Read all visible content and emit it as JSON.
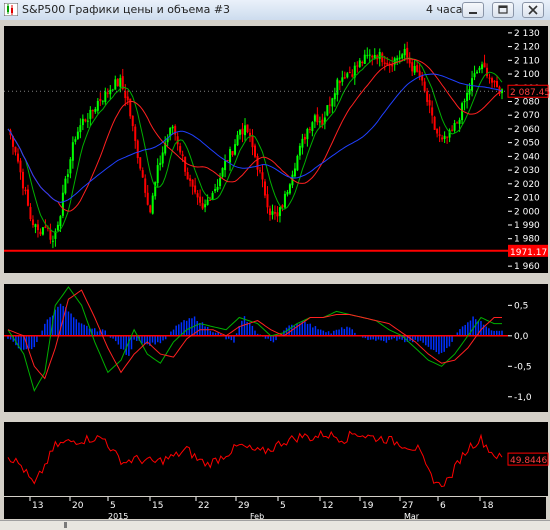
{
  "window": {
    "title": "S&P500 Графики цены и объема #3",
    "timeframe": "4 часа",
    "icon": "candlestick-chart-icon",
    "buttons": [
      "minimize-icon",
      "maximize-icon",
      "close-icon"
    ]
  },
  "colors": {
    "background": "#000000",
    "grid": "#5a5a5a",
    "bull_candle": "#00ff00",
    "bear_candle": "#ff0000",
    "ma_fast": "#00b000",
    "ma_mid": "#ff2020",
    "ma_slow": "#2040ff",
    "support_line": "#ff0000",
    "histogram": "#0030ff",
    "zero_line": "#ff0000",
    "oscillator": "#ff0000",
    "text": "#ffffff"
  },
  "chart_data": [
    {
      "type": "candlestick",
      "panel": "price",
      "ylim": [
        1955,
        2135
      ],
      "y_ticks": [
        "2 130",
        "2 120",
        "2 110",
        "2 100",
        "2 090",
        "2 080",
        "2 070",
        "2 060",
        "2 050",
        "2 040",
        "2 030",
        "2 020",
        "2 010",
        "2 000",
        "1 990",
        "1 980",
        "1 970",
        "1 960"
      ],
      "current_price_label": "2 087.45",
      "current_price": 2087.45,
      "support_label": "1971.17",
      "support_level": 1971.17,
      "series": [
        "MA fast (green)",
        "MA mid (red)",
        "MA slow (blue)"
      ],
      "close_path": [
        [
          0,
          2060
        ],
        [
          3,
          2045
        ],
        [
          6,
          2020
        ],
        [
          9,
          1995
        ],
        [
          12,
          1985
        ],
        [
          15,
          1990
        ],
        [
          18,
          1978
        ],
        [
          21,
          2000
        ],
        [
          24,
          2030
        ],
        [
          27,
          2055
        ],
        [
          30,
          2066
        ],
        [
          33,
          2070
        ],
        [
          36,
          2080
        ],
        [
          39,
          2085
        ],
        [
          42,
          2092
        ],
        [
          45,
          2094
        ],
        [
          48,
          2080
        ],
        [
          51,
          2050
        ],
        [
          54,
          2025
        ],
        [
          57,
          2000
        ],
        [
          60,
          2030
        ],
        [
          63,
          2050
        ],
        [
          66,
          2062
        ],
        [
          69,
          2045
        ],
        [
          72,
          2025
        ],
        [
          75,
          2010
        ],
        [
          78,
          2000
        ],
        [
          81,
          2012
        ],
        [
          84,
          2020
        ],
        [
          87,
          2035
        ],
        [
          90,
          2045
        ],
        [
          93,
          2060
        ],
        [
          96,
          2058
        ],
        [
          99,
          2040
        ],
        [
          102,
          2020
        ],
        [
          105,
          2000
        ],
        [
          108,
          1995
        ],
        [
          111,
          2010
        ],
        [
          114,
          2030
        ],
        [
          117,
          2045
        ],
        [
          120,
          2060
        ],
        [
          123,
          2070
        ],
        [
          126,
          2065
        ],
        [
          129,
          2080
        ],
        [
          132,
          2095
        ],
        [
          135,
          2100
        ],
        [
          138,
          2102
        ],
        [
          141,
          2108
        ],
        [
          144,
          2112
        ],
        [
          147,
          2115
        ],
        [
          150,
          2112
        ],
        [
          153,
          2108
        ],
        [
          156,
          2112
        ],
        [
          159,
          2115
        ],
        [
          162,
          2105
        ],
        [
          165,
          2098
        ],
        [
          168,
          2080
        ],
        [
          171,
          2060
        ],
        [
          174,
          2050
        ],
        [
          177,
          2055
        ],
        [
          180,
          2065
        ],
        [
          183,
          2080
        ],
        [
          186,
          2095
        ],
        [
          189,
          2105
        ],
        [
          192,
          2102
        ],
        [
          195,
          2090
        ],
        [
          198,
          2087.45
        ]
      ]
    },
    {
      "type": "histogram",
      "panel": "oscillator",
      "ylim": [
        -1.25,
        0.85
      ],
      "y_ticks": [
        "0,5",
        "0,0",
        "-0,5",
        "-1,0"
      ],
      "series": [
        "Histogram (blue)",
        "Signal green",
        "Signal red"
      ],
      "hist": [
        [
          0,
          -0.05
        ],
        [
          6,
          -0.25
        ],
        [
          10,
          -0.2
        ],
        [
          14,
          0.2
        ],
        [
          17,
          0.35
        ],
        [
          20,
          0.55
        ],
        [
          24,
          0.35
        ],
        [
          27,
          0.2
        ],
        [
          30,
          0.15
        ],
        [
          33,
          0.1
        ],
        [
          37,
          0.08
        ],
        [
          40,
          -0.05
        ],
        [
          43,
          -0.2
        ],
        [
          46,
          -0.35
        ],
        [
          48,
          -0.05
        ],
        [
          51,
          -0.1
        ],
        [
          53,
          -0.15
        ],
        [
          56,
          -0.12
        ],
        [
          59,
          -0.1
        ],
        [
          62,
          0.05
        ],
        [
          65,
          0.2
        ],
        [
          68,
          0.25
        ],
        [
          71,
          0.3
        ],
        [
          74,
          0.2
        ],
        [
          77,
          0.1
        ],
        [
          80,
          0.05
        ],
        [
          83,
          -0.05
        ],
        [
          86,
          -0.1
        ],
        [
          88,
          0.15
        ],
        [
          90,
          0.3
        ],
        [
          92,
          0.2
        ],
        [
          95,
          0.05
        ],
        [
          98,
          -0.05
        ],
        [
          101,
          -0.1
        ],
        [
          104,
          0.05
        ],
        [
          107,
          0.15
        ],
        [
          110,
          0.2
        ],
        [
          113,
          0.25
        ],
        [
          116,
          0.15
        ],
        [
          120,
          0.1
        ],
        [
          123,
          0.05
        ],
        [
          126,
          0.1
        ],
        [
          129,
          0.15
        ],
        [
          132,
          0.05
        ],
        [
          135,
          -0.05
        ],
        [
          138,
          -0.05
        ],
        [
          141,
          -0.08
        ],
        [
          144,
          -0.1
        ],
        [
          147,
          -0.05
        ],
        [
          150,
          -0.08
        ],
        [
          153,
          -0.1
        ],
        [
          156,
          -0.08
        ],
        [
          159,
          -0.15
        ],
        [
          162,
          -0.25
        ],
        [
          165,
          -0.3
        ],
        [
          168,
          -0.15
        ],
        [
          171,
          0.05
        ],
        [
          174,
          0.2
        ],
        [
          177,
          0.3
        ],
        [
          180,
          0.25
        ],
        [
          183,
          0.1
        ]
      ],
      "line_green": [
        [
          0,
          0.1
        ],
        [
          6,
          -0.3
        ],
        [
          10,
          -0.9
        ],
        [
          14,
          -0.6
        ],
        [
          18,
          0.5
        ],
        [
          23,
          0.8
        ],
        [
          28,
          0.5
        ],
        [
          33,
          -0.1
        ],
        [
          38,
          -0.6
        ],
        [
          43,
          -0.4
        ],
        [
          48,
          0.1
        ],
        [
          53,
          -0.3
        ],
        [
          58,
          -0.45
        ],
        [
          63,
          -0.1
        ],
        [
          68,
          0.1
        ],
        [
          73,
          0.2
        ],
        [
          78,
          0.15
        ],
        [
          83,
          0.1
        ],
        [
          88,
          0.3
        ],
        [
          95,
          0.2
        ],
        [
          100,
          0.0
        ],
        [
          105,
          0.05
        ],
        [
          110,
          0.2
        ],
        [
          115,
          0.3
        ],
        [
          120,
          0.3
        ],
        [
          125,
          0.4
        ],
        [
          130,
          0.35
        ],
        [
          135,
          0.3
        ],
        [
          140,
          0.25
        ],
        [
          145,
          0.1
        ],
        [
          150,
          0.0
        ],
        [
          155,
          -0.2
        ],
        [
          160,
          -0.4
        ],
        [
          165,
          -0.5
        ],
        [
          170,
          -0.3
        ],
        [
          175,
          0.0
        ],
        [
          180,
          0.3
        ],
        [
          185,
          0.2
        ]
      ],
      "line_red": [
        [
          0,
          0.1
        ],
        [
          6,
          0.0
        ],
        [
          10,
          -0.5
        ],
        [
          14,
          -0.7
        ],
        [
          18,
          -0.2
        ],
        [
          23,
          0.6
        ],
        [
          28,
          0.75
        ],
        [
          33,
          0.3
        ],
        [
          38,
          -0.2
        ],
        [
          43,
          -0.6
        ],
        [
          48,
          -0.3
        ],
        [
          53,
          -0.1
        ],
        [
          58,
          -0.3
        ],
        [
          63,
          -0.35
        ],
        [
          68,
          -0.05
        ],
        [
          73,
          0.1
        ],
        [
          78,
          0.1
        ],
        [
          83,
          0.0
        ],
        [
          88,
          0.15
        ],
        [
          95,
          0.25
        ],
        [
          100,
          0.1
        ],
        [
          105,
          0.0
        ],
        [
          110,
          0.15
        ],
        [
          115,
          0.3
        ],
        [
          120,
          0.3
        ],
        [
          125,
          0.35
        ],
        [
          130,
          0.35
        ],
        [
          135,
          0.3
        ],
        [
          140,
          0.25
        ],
        [
          145,
          0.2
        ],
        [
          150,
          0.05
        ],
        [
          155,
          -0.1
        ],
        [
          160,
          -0.3
        ],
        [
          165,
          -0.45
        ],
        [
          170,
          -0.4
        ],
        [
          175,
          -0.2
        ],
        [
          180,
          0.1
        ],
        [
          185,
          0.3
        ]
      ]
    },
    {
      "type": "line",
      "panel": "lower",
      "value_label": "49.8446",
      "value": 49.8446,
      "ylim": [
        0,
        100
      ],
      "series": [
        "Indicator (red)"
      ],
      "points": [
        [
          0,
          55
        ],
        [
          5,
          40
        ],
        [
          10,
          10
        ],
        [
          14,
          40
        ],
        [
          18,
          70
        ],
        [
          22,
          75
        ],
        [
          26,
          78
        ],
        [
          30,
          80
        ],
        [
          33,
          82
        ],
        [
          37,
          80
        ],
        [
          40,
          60
        ],
        [
          44,
          45
        ],
        [
          48,
          50
        ],
        [
          52,
          48
        ],
        [
          56,
          45
        ],
        [
          60,
          50
        ],
        [
          64,
          55
        ],
        [
          68,
          65
        ],
        [
          72,
          50
        ],
        [
          76,
          42
        ],
        [
          80,
          50
        ],
        [
          84,
          60
        ],
        [
          88,
          70
        ],
        [
          92,
          65
        ],
        [
          96,
          60
        ],
        [
          100,
          65
        ],
        [
          104,
          75
        ],
        [
          108,
          80
        ],
        [
          112,
          85
        ],
        [
          116,
          82
        ],
        [
          120,
          88
        ],
        [
          124,
          85
        ],
        [
          128,
          80
        ],
        [
          132,
          90
        ],
        [
          136,
          85
        ],
        [
          140,
          82
        ],
        [
          144,
          80
        ],
        [
          148,
          75
        ],
        [
          152,
          70
        ],
        [
          156,
          65
        ],
        [
          160,
          30
        ],
        [
          164,
          10
        ],
        [
          168,
          20
        ],
        [
          172,
          50
        ],
        [
          176,
          70
        ],
        [
          180,
          80
        ],
        [
          184,
          60
        ],
        [
          188,
          50
        ]
      ]
    }
  ],
  "x_axis": {
    "day_labels": [
      "13",
      "20",
      "5",
      "15",
      "22",
      "29",
      "5",
      "12",
      "19",
      "27",
      "6",
      "18"
    ],
    "month_labels": [
      "2015",
      "Feb",
      "Mar"
    ]
  }
}
